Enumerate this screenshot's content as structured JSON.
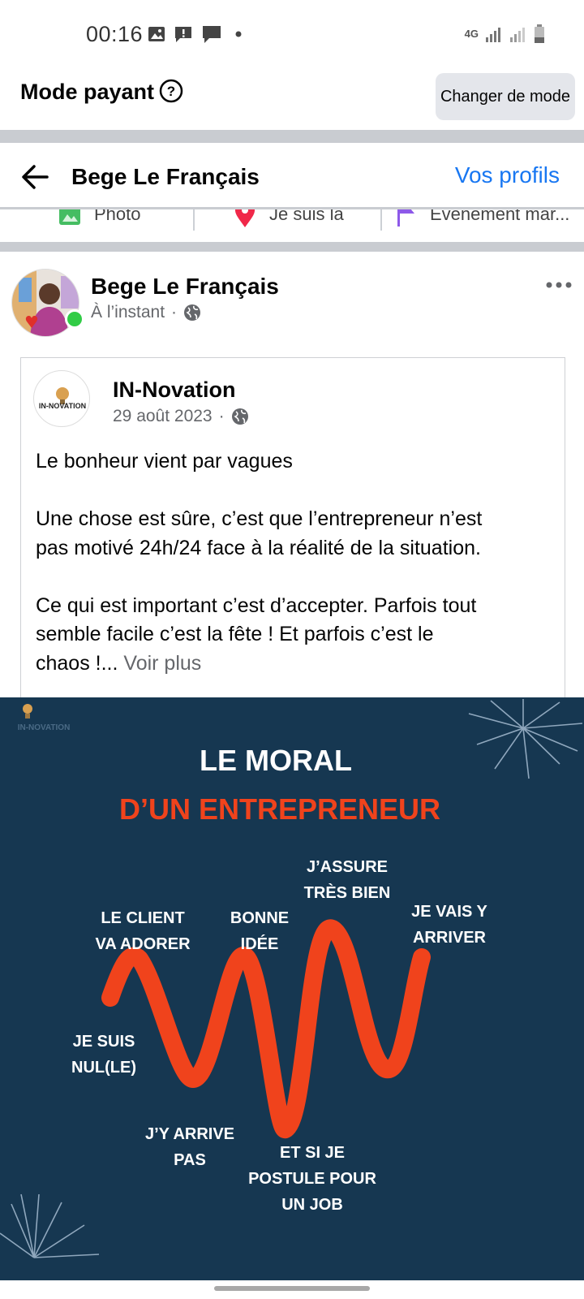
{
  "status_bar": {
    "time": "00:16",
    "network": "4G"
  },
  "mode": {
    "title": "Mode payant",
    "button_label": "Changer de mode"
  },
  "nav": {
    "title": "Bege Le Français",
    "profiles_link": "Vos profils"
  },
  "actions": [
    {
      "label": "Photo",
      "icon": "photo-icon",
      "color": "#45bd62"
    },
    {
      "label": "Je suis là",
      "icon": "location-pin-icon",
      "color": "#f02849"
    },
    {
      "label": "Événement mar...",
      "icon": "flag-icon",
      "color": "#8d59e9"
    }
  ],
  "post": {
    "author": "Bege Le Français",
    "time": "À l’instant",
    "shared": {
      "page_name": "IN-Novation",
      "date": "29 août 2023",
      "text_lines": [
        "Le bonheur vient par vagues",
        "",
        "Une chose est sûre, c’est que l’entrepreneur n’est",
        "pas motivé 24h/24 face à la réalité de la situation.",
        "",
        "Ce qui est important c’est d’accepter. Parfois tout",
        "semble facile c’est la fête !  Et parfois c’est le"
      ],
      "last_line": "chaos !...",
      "see_more": "Voir plus"
    },
    "image": {
      "logo_text": "IN-NOVATION",
      "title_line1": "LE MORAL",
      "title_line2": "D’UN ENTREPRENEUR",
      "labels": [
        {
          "line1": "LE CLIENT",
          "line2": "VA ADORER"
        },
        {
          "line1": "BONNE",
          "line2": "IDÉE"
        },
        {
          "line1": "J’ASSURE",
          "line2": "TRÈS BIEN"
        },
        {
          "line1": "JE VAIS Y",
          "line2": "ARRIVER"
        },
        {
          "line1": "JE SUIS",
          "line2": "NUL(LE)"
        },
        {
          "line1": "J’Y ARRIVE",
          "line2": "PAS"
        },
        {
          "line1": "ET SI JE",
          "line2": "POSTULE POUR",
          "line3": "UN JOB"
        }
      ]
    }
  },
  "colors": {
    "link_blue": "#1877f2",
    "online_green": "#31cc46",
    "graphic_background": "#163751",
    "wave_orange": "#f0431c"
  }
}
